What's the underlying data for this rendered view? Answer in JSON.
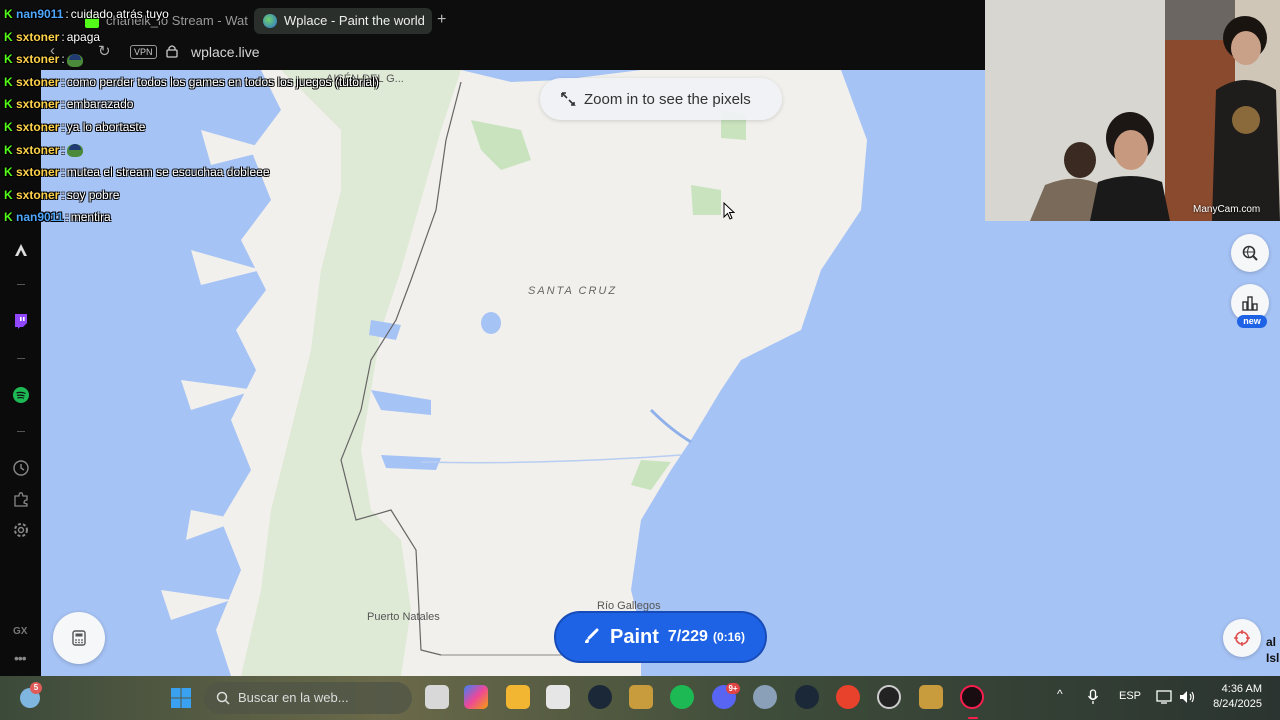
{
  "browser": {
    "tabs": [
      {
        "label": "chanelk_lo Stream - Wat",
        "active": false
      },
      {
        "label": "Wplace - Paint the world",
        "active": true
      }
    ],
    "new_tab_symbol": "+",
    "vpn_label": "VPN",
    "url": "wplace.live"
  },
  "map": {
    "zoom_hint": "Zoom in to see the pixels",
    "region_label": "SANTA CRUZ",
    "places": [
      "Puerto Natales",
      "Río Gallegos"
    ],
    "top_label": "AISÉN DEL G...",
    "edge_text": [
      "al",
      "Isl"
    ],
    "paint_button": {
      "label": "Paint",
      "count": "7/229",
      "timer": "(0:16)"
    },
    "new_badge": "new",
    "colors": {
      "ocean": "#a6c3f5",
      "land": "#f1f0ec",
      "parks": "#c9e3be",
      "accent": "#1e63e6"
    }
  },
  "chat": [
    {
      "user": "nan9011",
      "user_color": "#4ea7ff",
      "message": "cuidado atrás tuyo"
    },
    {
      "user": "sxtoner",
      "user_color": "#ffd24a",
      "message": "apaga"
    },
    {
      "user": "sxtoner",
      "user_color": "#ffd24a",
      "message": "",
      "emote": "pepe"
    },
    {
      "user": "sxtoner",
      "user_color": "#ffd24a",
      "message": "como perder todos los games en todos los juegos (tutorial)"
    },
    {
      "user": "sxtoner",
      "user_color": "#ffd24a",
      "message": "embarazado"
    },
    {
      "user": "sxtoner",
      "user_color": "#ffd24a",
      "message": "ya lo abortaste"
    },
    {
      "user": "sxtoner",
      "user_color": "#ffd24a",
      "message": "",
      "emote": "pepe"
    },
    {
      "user": "sxtoner",
      "user_color": "#ffd24a",
      "message": "mutea el stream se escuchaa dobleee"
    },
    {
      "user": "sxtoner",
      "user_color": "#ffd24a",
      "message": "soy pobre"
    },
    {
      "user": "nan9011",
      "user_color": "#4ea7ff",
      "message": "mentira"
    }
  ],
  "chat_separator": ":",
  "sidebar": {
    "gx_label": "GX",
    "more_label": "•••"
  },
  "webcam": {
    "watermark": "ManyCam.com"
  },
  "taskbar": {
    "search_placeholder": "Buscar en la web...",
    "weather_badge": "5",
    "discord_badge": "9+",
    "language": "ESP",
    "time": "4:36 AM",
    "date": "8/24/2025"
  }
}
